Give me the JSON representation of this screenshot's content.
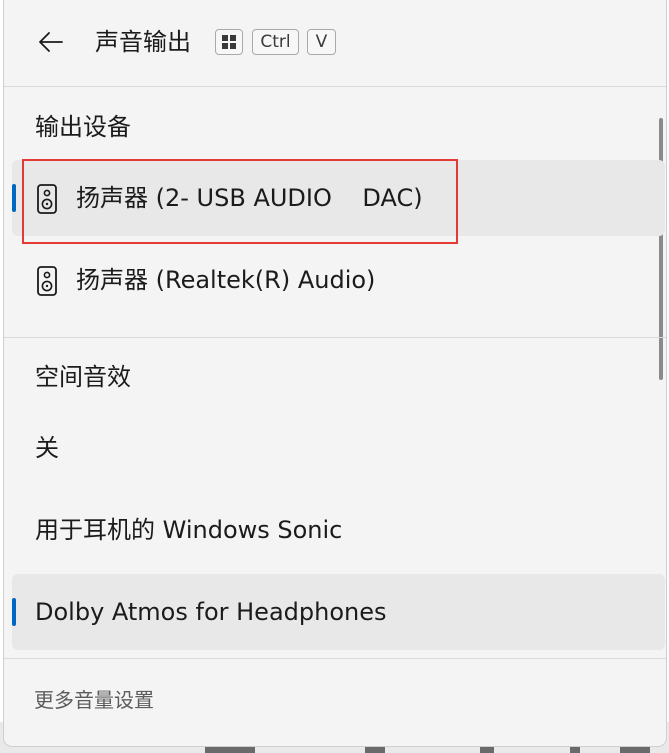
{
  "header": {
    "title": "声音输出",
    "shortcut_keys": [
      "",
      "Ctrl",
      "V"
    ]
  },
  "output_devices": {
    "heading": "输出设备",
    "items": [
      {
        "label": "扬声器 (2- USB AUDIO    DAC)",
        "icon": "speaker-icon",
        "selected": true
      },
      {
        "label": "扬声器 (Realtek(R) Audio)",
        "icon": "speaker-icon",
        "selected": false
      }
    ]
  },
  "spatial_audio": {
    "heading": "空间音效",
    "items": [
      {
        "label": "关",
        "selected": false
      },
      {
        "label": "用于耳机的 Windows Sonic",
        "selected": false
      },
      {
        "label": "Dolby Atmos for Headphones",
        "selected": true
      }
    ]
  },
  "footer": {
    "more_settings": "更多音量设置"
  },
  "colors": {
    "accent": "#0067c0",
    "annotation": "#e53935"
  }
}
